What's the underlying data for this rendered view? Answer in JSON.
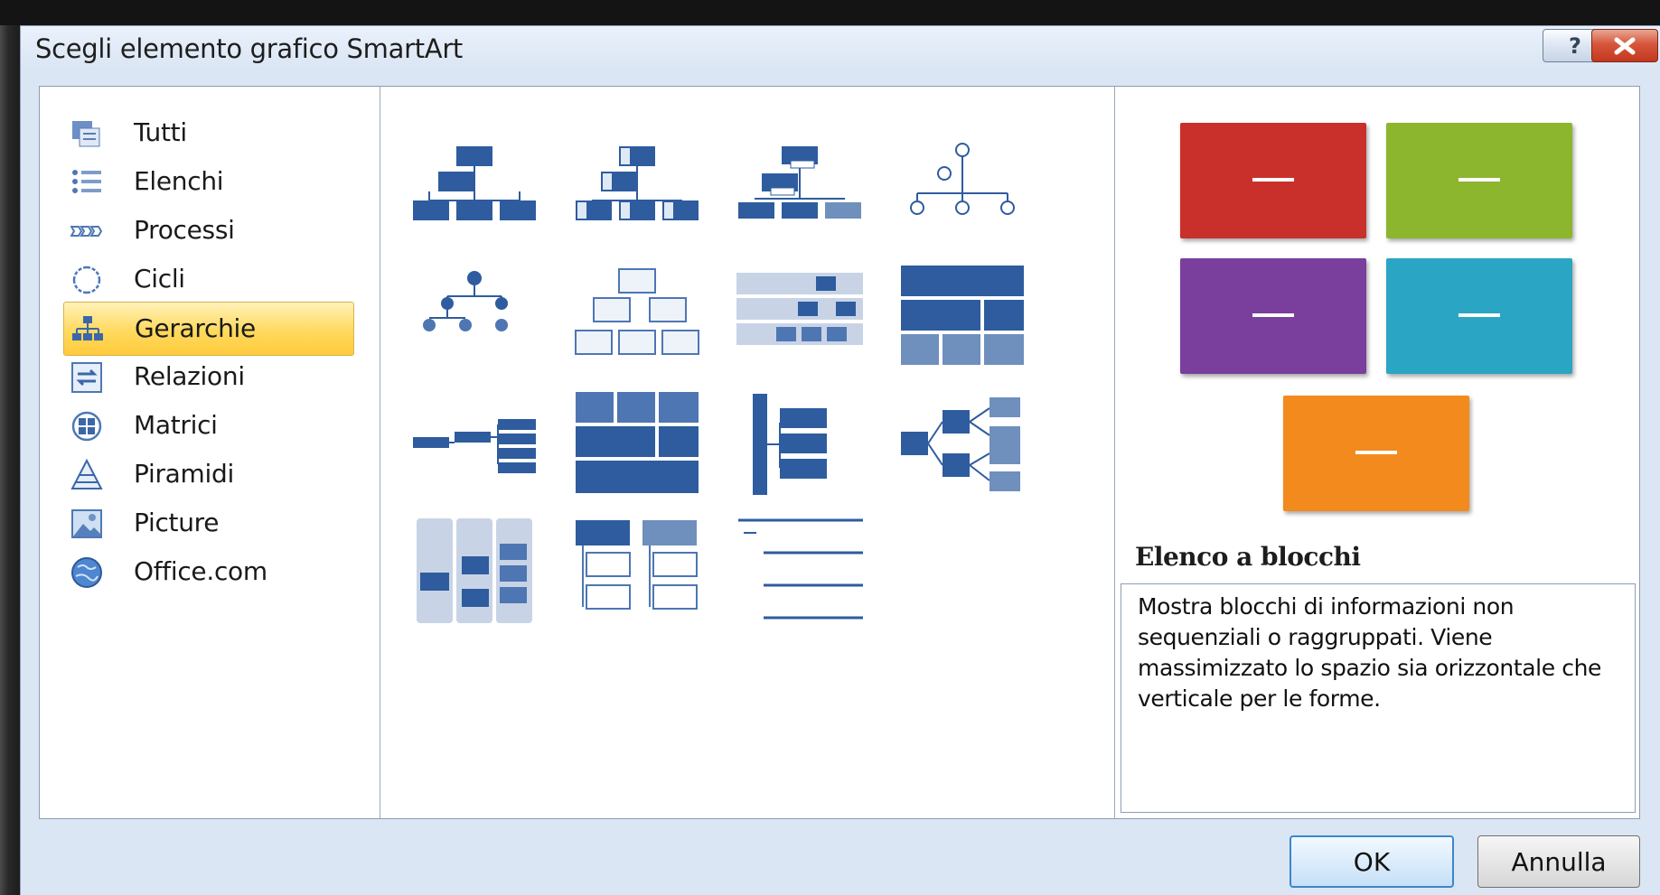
{
  "window": {
    "title": "Scegli elemento grafico SmartArt"
  },
  "title_buttons": {
    "help": "?"
  },
  "categories": [
    {
      "label": "Tutti",
      "icon": "all-layouts-icon",
      "selected": false
    },
    {
      "label": "Elenchi",
      "icon": "list-icon",
      "selected": false
    },
    {
      "label": "Processi",
      "icon": "process-icon",
      "selected": false
    },
    {
      "label": "Cicli",
      "icon": "cycle-icon",
      "selected": false
    },
    {
      "label": "Gerarchie",
      "icon": "hierarchy-icon",
      "selected": true
    },
    {
      "label": "Relazioni",
      "icon": "relationship-icon",
      "selected": false
    },
    {
      "label": "Matrici",
      "icon": "matrix-icon",
      "selected": false
    },
    {
      "label": "Piramidi",
      "icon": "pyramid-icon",
      "selected": false
    },
    {
      "label": "Picture",
      "icon": "picture-icon",
      "selected": false
    },
    {
      "label": "Office.com",
      "icon": "globe-icon",
      "selected": false
    }
  ],
  "preview": {
    "layout_name": "Elenco a blocchi",
    "description": "Mostra blocchi di informazioni non sequenziali o raggruppati. Viene massimizzato lo spazio sia orizzontale che verticale per le forme.",
    "block_colors": [
      "#c9302c",
      "#8bb62e",
      "#7a3f9d",
      "#2aa6c4",
      "#f28a1d"
    ]
  },
  "buttons": {
    "ok": "OK",
    "cancel": "Annulla"
  },
  "colors": {
    "accent": "#3a6aa9",
    "selection": "#ffd95e"
  }
}
